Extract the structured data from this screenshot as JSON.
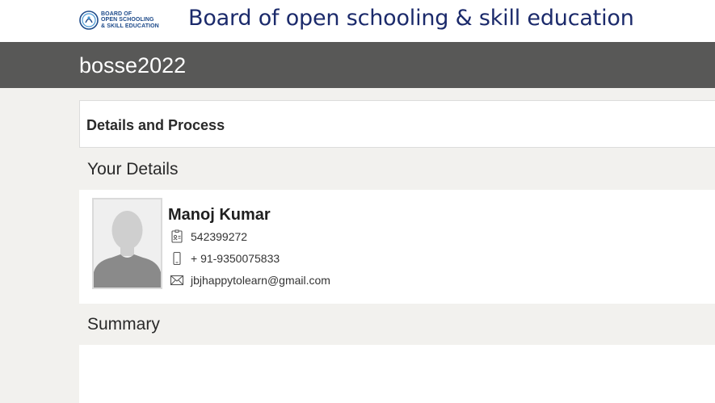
{
  "header": {
    "logo_lines": [
      "BOARD OF",
      "OPEN SCHOOLING",
      "& SKILL EDUCATION"
    ],
    "site_title": "Board of open schooling & skill education"
  },
  "banner": {
    "title": "bosse2022"
  },
  "process_panel": {
    "title": "Details and Process"
  },
  "details": {
    "heading": "Your Details",
    "name": "Manoj Kumar",
    "id_number": "542399272",
    "phone": "+ 91-9350075833",
    "email": "jbjhappytolearn@gmail.com"
  },
  "summary": {
    "heading": "Summary"
  },
  "icons": {
    "id": "id-card-icon",
    "phone": "mobile-phone-icon",
    "email": "envelope-icon",
    "logo": "logo-icon",
    "avatar": "person-silhouette"
  },
  "colors": {
    "banner_bg": "#585857",
    "page_bg": "#f2f1ee",
    "title_blue": "#1b2a6b",
    "logo_blue": "#1d4a8a"
  }
}
